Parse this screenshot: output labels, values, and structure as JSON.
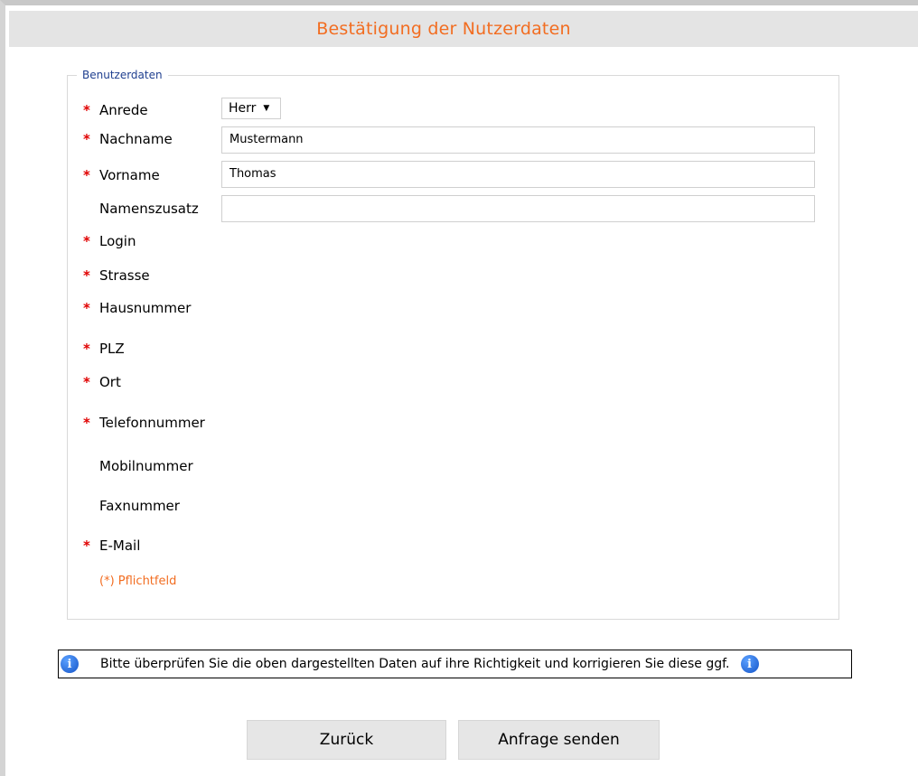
{
  "title": "Bestätigung der Nutzerdaten",
  "legend": "Benutzerdaten",
  "fields": {
    "anrede": {
      "label": "Anrede",
      "required": "*",
      "value": "Herr"
    },
    "nachname": {
      "label": "Nachname",
      "required": "*",
      "value": "Mustermann"
    },
    "vorname": {
      "label": "Vorname",
      "required": "*",
      "value": "Thomas"
    },
    "namenszusatz": {
      "label": "Namenszusatz",
      "value": ""
    },
    "login": {
      "label": "Login",
      "required": "*"
    },
    "strasse": {
      "label": "Strasse",
      "required": "*"
    },
    "hausnummer": {
      "label": "Hausnummer",
      "required": "*"
    },
    "plz": {
      "label": "PLZ",
      "required": "*"
    },
    "ort": {
      "label": "Ort",
      "required": "*"
    },
    "telefonnummer": {
      "label": "Telefonnummer",
      "required": "*"
    },
    "mobilnummer": {
      "label": "Mobilnummer"
    },
    "faxnummer": {
      "label": "Faxnummer"
    },
    "email": {
      "label": "E-Mail",
      "required": "*"
    }
  },
  "required_note": "(*) Pflichtfeld",
  "info_message": "Bitte überprüfen Sie die oben dargestellten Daten auf ihre Richtigkeit und korrigieren Sie diese ggf.",
  "icons": {
    "info_left": "info-icon",
    "info_right": "info-icon",
    "dropdown": "chevron-down-icon"
  },
  "buttons": {
    "back": "Zurück",
    "submit": "Anfrage senden"
  },
  "colors": {
    "accent": "#f26d21",
    "required": "#e00000",
    "legend": "#1f3f8f",
    "info": "#1555c8"
  }
}
